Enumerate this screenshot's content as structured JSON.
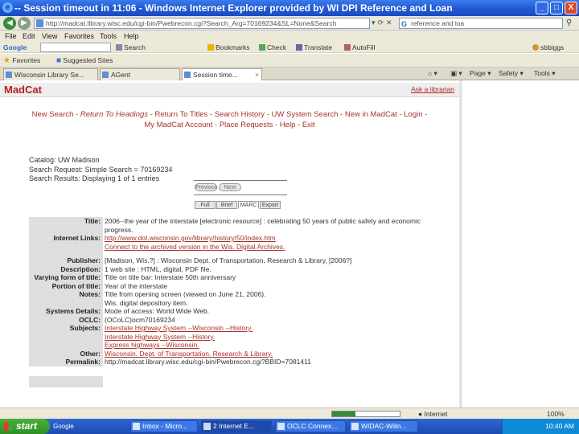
{
  "window": {
    "title": "-- Session timeout in 11:06 - Windows Internet Explorer provided by WI DPI Reference and Loan",
    "minimize": "_",
    "maximize": "□",
    "close": "X"
  },
  "address": {
    "url": "http://madcat.library.wisc.edu/cgi-bin/Pwebrecon.cgi?Search_Arg=70169234&SL=None&Search",
    "search_text": "reference and loa"
  },
  "menu": {
    "file": "File",
    "edit": "Edit",
    "view": "View",
    "favorites": "Favorites",
    "tools": "Tools",
    "help": "Help"
  },
  "google_toolbar": {
    "brand": "Google",
    "search": "Search",
    "bookmarks": "Bookmarks",
    "check": "Check",
    "translate": "Translate",
    "autofill": "AutoFill",
    "user": "sbbiggs"
  },
  "favorites_bar": {
    "favorites": "Favorites",
    "suggested": "Suggested Sites"
  },
  "tabs": [
    {
      "label": "Wisconsin Library Se..."
    },
    {
      "label": "AGent"
    },
    {
      "label": "Session time..."
    }
  ],
  "ie_tools": {
    "page": "Page",
    "safety": "Safety",
    "tools": "Tools"
  },
  "madcat": {
    "logo": "MadCat",
    "ask": "Ask a librarian",
    "nav": [
      {
        "label": "New Search",
        "italic": false
      },
      {
        "label": "Return To Headings",
        "italic": true
      },
      {
        "label": "Return To Titles",
        "italic": false
      },
      {
        "label": "Search History",
        "italic": false
      },
      {
        "label": "UW System Search",
        "italic": false
      },
      {
        "label": "New in MadCat",
        "italic": false
      },
      {
        "label": "Login",
        "italic": false
      },
      {
        "label": "My MadCat Account",
        "italic": false
      },
      {
        "label": "Place Requests",
        "italic": false
      },
      {
        "label": "Help",
        "italic": false
      },
      {
        "label": "Exit",
        "italic": false
      }
    ],
    "catalog": "Catalog: UW Madison",
    "search_request": "Search Request: Simple Search = 70169234",
    "search_results": "Search Results: Displaying 1 of 1 entries",
    "pager": {
      "prev": "Previous",
      "next": "Next"
    },
    "views": [
      {
        "label": "Full",
        "active": false
      },
      {
        "label": "Brief",
        "active": false
      },
      {
        "label": "MARC",
        "active": true
      },
      {
        "label": "Export",
        "active": false
      }
    ],
    "record": [
      {
        "label": "Title:",
        "value": "2006--the year of the interstate [electronic resource] : celebrating 50 years of public safety and economic",
        "link": false
      },
      {
        "label": "",
        "value": "progress.",
        "link": false
      },
      {
        "label": "Internet Links:",
        "value": "http://www.dot.wisconsin.gov/library/history/50/index.htm",
        "link": true
      },
      {
        "label": "",
        "value": "Connect to the archived version in the Wis. Digital Archives.",
        "link": true
      },
      {
        "label": "",
        "value": "",
        "link": false,
        "gap": true
      },
      {
        "label": "Publisher:",
        "value": "[Madison, Wis.?] : Wisconsin Dept. of Transportation, Research & Library, [2006?]",
        "link": false
      },
      {
        "label": "Description:",
        "value": "1 web site : HTML, digital, PDF file.",
        "link": false
      },
      {
        "label": "Varying form of title:",
        "value": "Title on title bar: Interstate 50th anniversary",
        "link": false
      },
      {
        "label": "Portion of title:",
        "value": "Year of the interstate",
        "link": false
      },
      {
        "label": "Notes:",
        "value": "Title from opening screen (viewed on June 21, 2006).",
        "link": false
      },
      {
        "label": "",
        "value": "Wis. digital depository item.",
        "link": false
      },
      {
        "label": "Systems Details:",
        "value": "Mode of access: World Wide Web.",
        "link": false
      },
      {
        "label": "OCLC:",
        "value": "(OCoLC)ocm70169234",
        "link": false
      },
      {
        "label": "Subjects:",
        "value": "Interstate Highway System --Wisconsin --History.",
        "link": true
      },
      {
        "label": "",
        "value": "Interstate Highway System --History.",
        "link": true
      },
      {
        "label": "",
        "value": "Express highways --Wisconsin.",
        "link": true
      },
      {
        "label": "Other:",
        "value": "Wisconsin. Dept. of Transportation. Research & Library.",
        "link": true
      },
      {
        "label": "Permalink:",
        "value": "http://madcat.library.wisc.edu/cgi-bin/Pwebrecon.cgi?BBID=7081411",
        "link": false
      }
    ]
  },
  "status": {
    "zone": "Internet",
    "zoom": "100%",
    "progress": 0.35
  },
  "taskbar": {
    "start": "start",
    "quick": "Google",
    "tasks": [
      {
        "label": "Inbox - Micro..."
      },
      {
        "label": "2 Internet E..."
      },
      {
        "label": "OCLC Connex..."
      },
      {
        "label": "WIDAC-Wilin..."
      }
    ],
    "clock": "10:40 AM"
  }
}
